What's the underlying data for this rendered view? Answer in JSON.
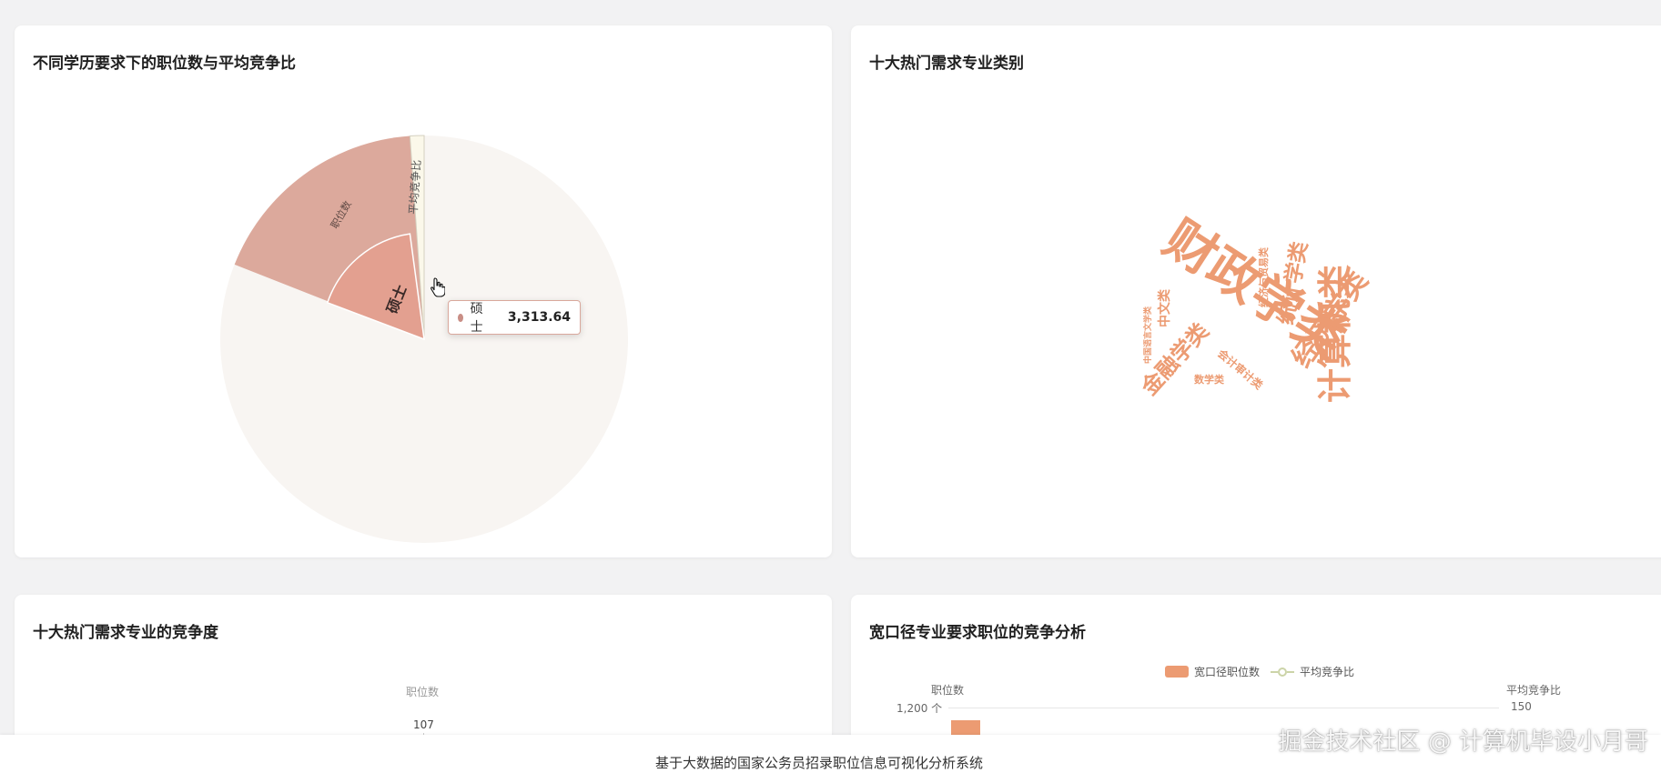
{
  "cards": {
    "pie": {
      "title": "不同学历要求下的职位数与平均竞争比"
    },
    "cloud": {
      "title": "十大热门需求专业类别"
    },
    "comp": {
      "title": "十大热门需求专业的竞争度"
    },
    "wide": {
      "title": "宽口径专业要求职位的竞争分析"
    }
  },
  "tooltip": {
    "label": "硕士",
    "value": "3,313.64"
  },
  "chart_data": [
    {
      "type": "pie",
      "title": "不同学历要求下的职位数与平均竞争比",
      "visible_labels": [
        "硕士",
        "职位数",
        "平均竞争比"
      ],
      "highlighted_slice": {
        "name": "硕士",
        "value": 3313.64
      }
    },
    {
      "type": "wordcloud",
      "title": "十大热门需求专业类别",
      "words": [
        "财政学类",
        "计算机类",
        "经济学类",
        "统计学类",
        "金融学类",
        "经济与贸易类",
        "会计审计类",
        "中文类",
        "中国语言文学类",
        "数学类"
      ],
      "color": "#ec9b72"
    },
    {
      "type": "bar",
      "title": "十大热门需求专业的竞争度",
      "ylabel": "职位数",
      "visible_values": [
        107
      ]
    },
    {
      "type": "bar+line",
      "title": "宽口径专业要求职位的竞争分析",
      "legend": [
        "宽口径职位数",
        "平均竞争比"
      ],
      "ylabel_left": "职位数",
      "ylabel_right": "平均竞争比",
      "left_max_label": "1,200 个",
      "right_max_label": "150",
      "colors": {
        "bar": "#ec9b72",
        "line": "#ccd4a8"
      }
    }
  ],
  "comp_chart": {
    "ylabel": "职位数",
    "value_label": "107"
  },
  "wide_chart": {
    "legend_bar": "宽口径职位数",
    "legend_line": "平均竞争比",
    "ylabel_left": "职位数",
    "ylabel_right": "平均竞争比",
    "left_tick": "1,200 个",
    "right_tick": "150"
  },
  "footer": {
    "text": "基于大数据的国家公务员招录职位信息可视化分析系统"
  },
  "watermark": {
    "text": "掘金技术社区 @ 计算机毕设小月哥"
  },
  "cloud_words": {
    "w1": "财政学类",
    "w2": "计算机类",
    "w3": "经济学类",
    "w4": "统计学类",
    "w5": "金融学类",
    "w6": "经济与贸易类",
    "w7": "会计审计类",
    "w8": "中文类",
    "w9": "中国语言文学类",
    "w10": "数学类"
  },
  "pie_labels": {
    "inner": "硕士",
    "outer": "职位数",
    "thin": "平均竞争比"
  }
}
